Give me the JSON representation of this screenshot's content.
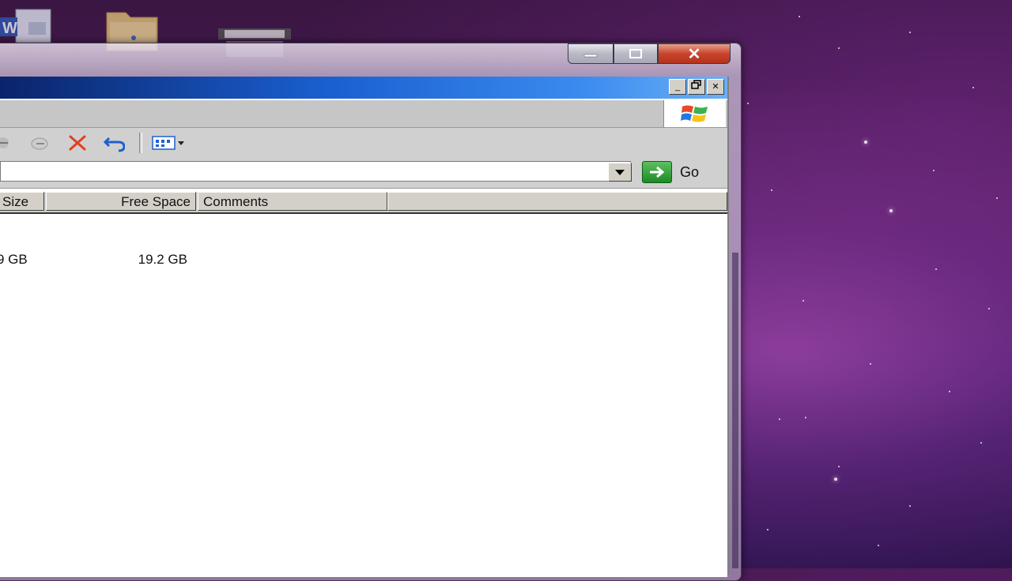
{
  "desktop": {
    "icons": [
      {
        "name": "word-document-icon"
      },
      {
        "name": "folder-icon"
      },
      {
        "name": "drive-icon"
      }
    ]
  },
  "outer_window": {
    "minimize_label": "",
    "maximize_label": "",
    "close_label": "✕"
  },
  "inner_window": {
    "title": "",
    "menu": [],
    "toolbar": {
      "icons": [
        "move-to-icon",
        "copy-to-icon",
        "delete-icon",
        "undo-icon",
        "views-icon"
      ]
    },
    "address": {
      "value": "",
      "go_label": "Go"
    },
    "columns": [
      "Size",
      "Free Space",
      "Comments"
    ],
    "rows": [
      {
        "size": "9 GB",
        "free_space": "19.2 GB",
        "comments": ""
      }
    ]
  },
  "colors": {
    "xp_title_start": "#0a246a",
    "xp_title_end": "#6bb0f5",
    "close_red": "#c9442c",
    "go_green": "#1e8a28"
  }
}
